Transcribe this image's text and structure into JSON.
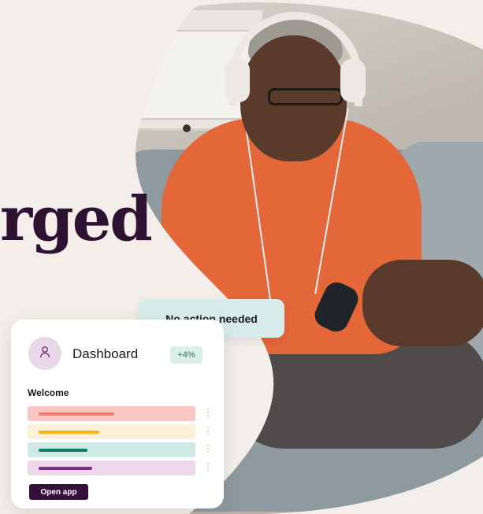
{
  "headline": {
    "text": "rged"
  },
  "chip": {
    "label": "No action needed"
  },
  "dashboard": {
    "title": "Dashboard",
    "badge": "+4%",
    "welcome": "Welcome",
    "rows": [
      {
        "bg": "#f9c7c3",
        "bar": "#ef7a6e",
        "fill": 0.45
      },
      {
        "bg": "#fdf0d6",
        "bar": "#f6b60f",
        "fill": 0.36
      },
      {
        "bg": "#cfe9e4",
        "bar": "#167a6b",
        "fill": 0.29
      },
      {
        "bg": "#ecd8ea",
        "bar": "#7d2c8c",
        "fill": 0.32
      }
    ],
    "open_button": "Open app"
  },
  "colors": {
    "background": "#f3eee9",
    "brand_dark": "#2f1232",
    "accent_teal": "#d7ecea"
  },
  "icons": {
    "avatar": "user-icon"
  }
}
